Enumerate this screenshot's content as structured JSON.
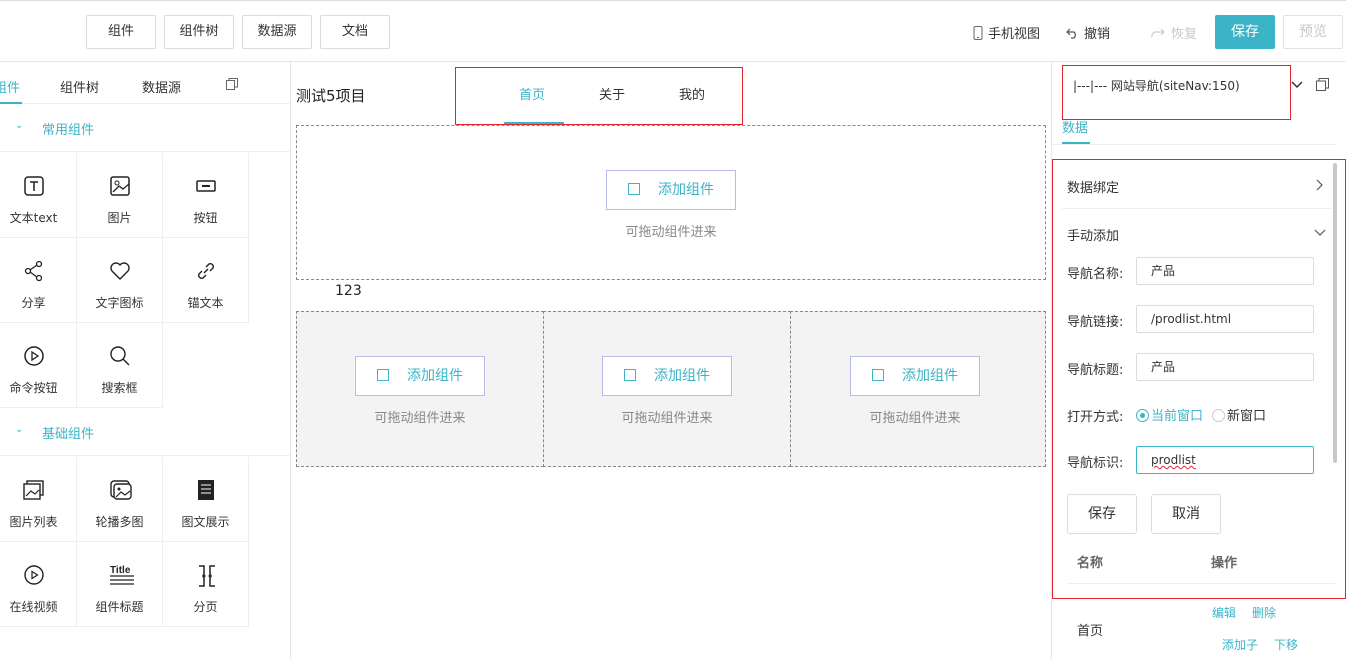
{
  "topbar": {
    "tabs": [
      "组件",
      "组件树",
      "数据源",
      "文档"
    ],
    "mobile_view": "手机视图",
    "undo": "撤销",
    "redo": "恢复",
    "save": "保存",
    "preview": "预览"
  },
  "left": {
    "tabs": [
      "组件",
      "组件树",
      "数据源"
    ],
    "active_tab_partial": "组件",
    "groups": [
      {
        "title": "常用组件",
        "items": [
          {
            "label": "文本text",
            "icon": "text-icon"
          },
          {
            "label": "图片",
            "icon": "image-icon"
          },
          {
            "label": "按钮",
            "icon": "button-icon"
          },
          {
            "label": "分享",
            "icon": "share-icon"
          },
          {
            "label": "文字图标",
            "icon": "heart-icon"
          },
          {
            "label": "锚文本",
            "icon": "link-icon"
          },
          {
            "label": "命令按钮",
            "icon": "play-circle-icon"
          },
          {
            "label": "搜索框",
            "icon": "search-icon"
          }
        ]
      },
      {
        "title": "基础组件",
        "items": [
          {
            "label": "图片列表",
            "icon": "image-list-icon"
          },
          {
            "label": "轮播多图",
            "icon": "carousel-icon"
          },
          {
            "label": "图文展示",
            "icon": "document-icon"
          },
          {
            "label": "在线视频",
            "icon": "video-icon"
          },
          {
            "label": "组件标题",
            "icon": "title-icon"
          },
          {
            "label": "分页",
            "icon": "pagination-icon"
          }
        ]
      }
    ]
  },
  "canvas": {
    "project_title": "测试5项目",
    "nav": [
      "首页",
      "关于",
      "我的"
    ],
    "text_123": "123",
    "add_label": "添加组件",
    "drag_hint": "可拖动组件进来"
  },
  "right": {
    "selected": "|---|--- 网站导航(siteNav:150)",
    "tab": "数据",
    "data_binding": "数据绑定",
    "manual_add": "手动添加",
    "fields": {
      "name_label": "导航名称:",
      "name_value": "产品",
      "link_label": "导航链接:",
      "link_value": "/prodlist.html",
      "title_label": "导航标题:",
      "title_value": "产品",
      "open_label": "打开方式:",
      "open_current": "当前窗口",
      "open_new": "新窗口",
      "ident_label": "导航标识:",
      "ident_value": "prodlist"
    },
    "save": "保存",
    "cancel": "取消",
    "table": {
      "col_name": "名称",
      "col_op": "操作",
      "rows": [
        {
          "name": "首页",
          "ops": [
            "编辑",
            "删除",
            "添加子",
            "下移"
          ]
        }
      ]
    }
  }
}
